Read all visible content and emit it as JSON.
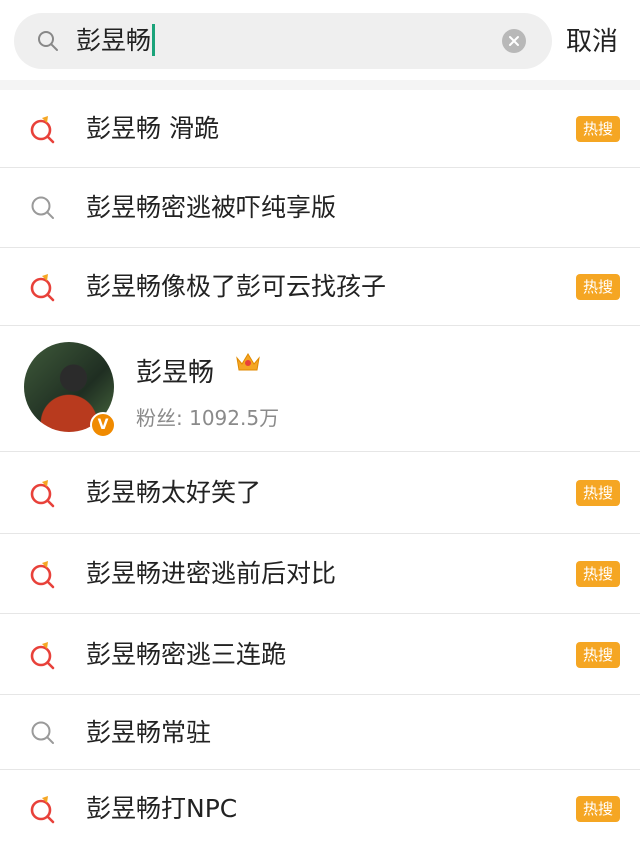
{
  "search": {
    "query": "彭昱畅",
    "cancel_label": "取消"
  },
  "colors": {
    "hot_badge": "#f5a623",
    "caret": "#1aa37a",
    "hot_icon_red": "#e8413a",
    "hot_icon_orange": "#f5a623"
  },
  "results": [
    {
      "text": "彭昱畅 滑跪",
      "hot": true,
      "badge": "热搜"
    },
    {
      "text": "彭昱畅密逃被吓纯享版",
      "hot": false,
      "badge": ""
    },
    {
      "text": "彭昱畅像极了彭可云找孩子",
      "hot": true,
      "badge": "热搜"
    }
  ],
  "user": {
    "name": "彭昱畅",
    "fans": "粉丝: 1092.5万",
    "verified_mark": "V"
  },
  "results_after": [
    {
      "text": "彭昱畅太好笑了",
      "hot": true,
      "badge": "热搜"
    },
    {
      "text": "彭昱畅进密逃前后对比",
      "hot": true,
      "badge": "热搜"
    },
    {
      "text": "彭昱畅密逃三连跪",
      "hot": true,
      "badge": "热搜"
    },
    {
      "text": "彭昱畅常驻",
      "hot": false,
      "badge": ""
    },
    {
      "text": "彭昱畅打NPC",
      "hot": true,
      "badge": "热搜"
    }
  ]
}
